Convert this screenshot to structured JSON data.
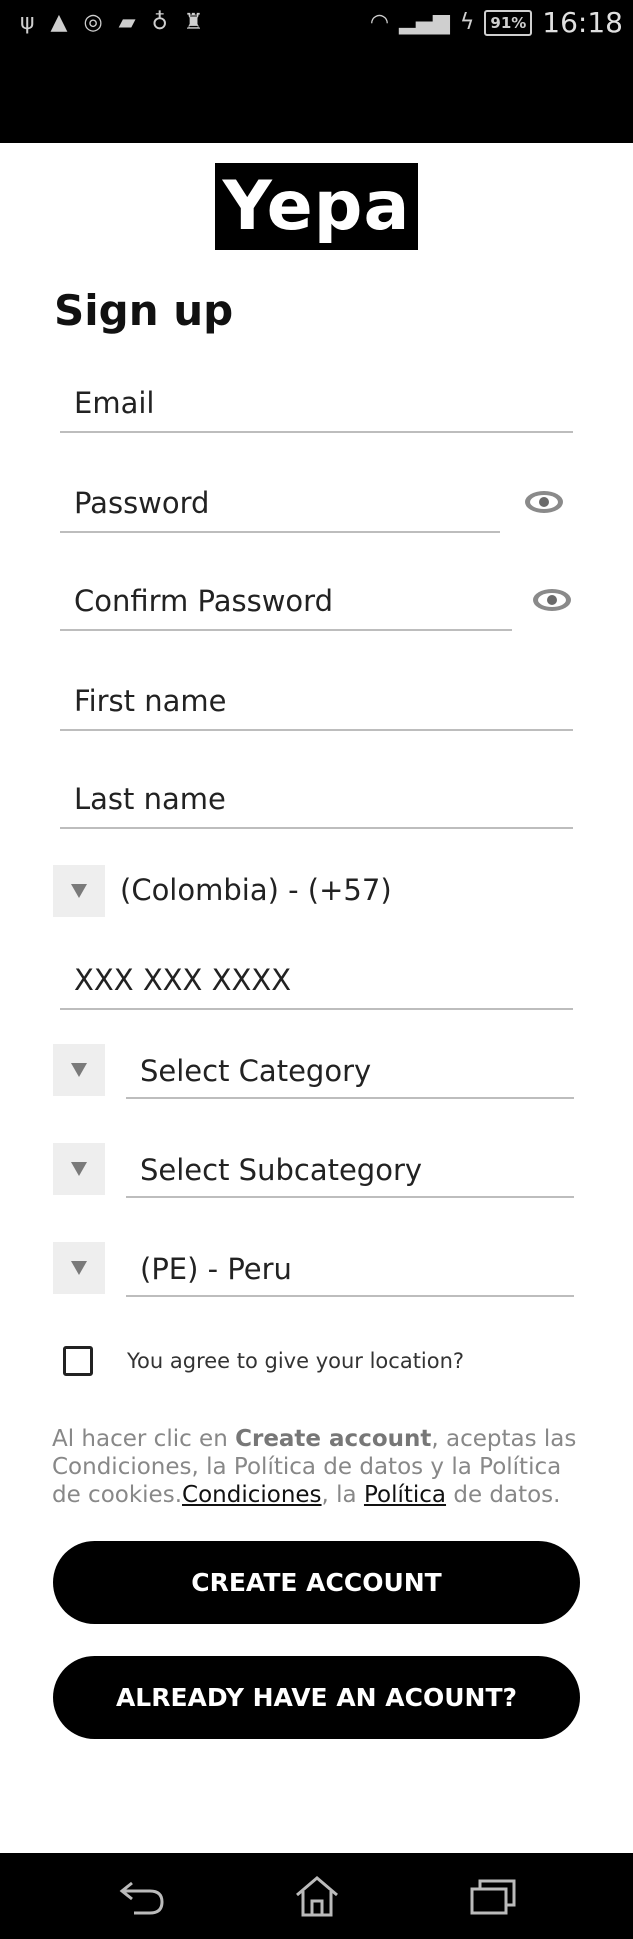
{
  "status_bar": {
    "left_icons": [
      "usb-icon",
      "warning-icon",
      "whatsapp-icon",
      "sim-icon",
      "lightbulb-icon",
      "android-icon"
    ],
    "battery": "91%",
    "time": "16:18"
  },
  "logo": {
    "text": "Yepa"
  },
  "page": {
    "title": "Sign up"
  },
  "form": {
    "email_placeholder": "Email",
    "password_placeholder": "Password",
    "confirm_password_placeholder": "Confirm Password",
    "first_name_placeholder": "First name",
    "last_name_placeholder": "Last name",
    "country_code": "(Colombia) - (+57)",
    "phone_placeholder": "XXX XXX XXXX",
    "category": "Select Category",
    "subcategory": "Select Subcategory",
    "country": "(PE) - Peru",
    "location_label": "You agree to give your location?"
  },
  "legal": {
    "prefix": "Al hacer clic en ",
    "bold": "Create account",
    "middle": ", aceptas las Condiciones, la Política de datos y la Política de cookies.",
    "link_conditions": "Condiciones",
    "sep": ", la ",
    "link_policy": "Política",
    "suffix": " de datos."
  },
  "buttons": {
    "create_account": "CREATE ACCOUNT",
    "already_have": "ALREADY HAVE AN ACOUNT?"
  },
  "nav": [
    "back-icon",
    "home-icon",
    "recent-apps-icon"
  ]
}
